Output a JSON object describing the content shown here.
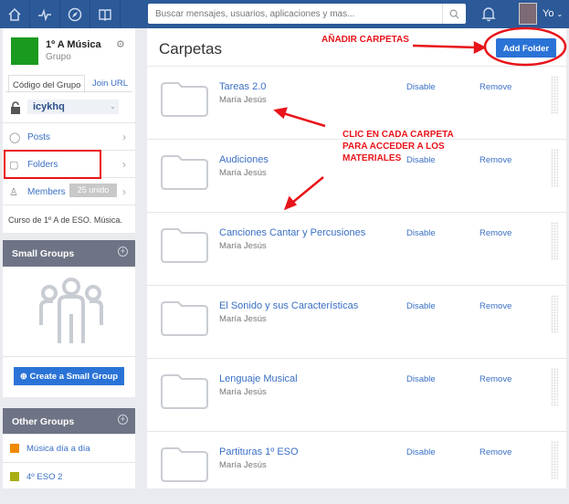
{
  "topbar": {
    "search_placeholder": "Buscar mensajes, usuarios, aplicaciones y mas...",
    "user": "Yo"
  },
  "group": {
    "name": "1º A Música",
    "type": "Grupo",
    "tab_code": "Código del Grupo",
    "tab_join": "Join URL",
    "code": "icykhq",
    "menu": [
      {
        "label": "Posts"
      },
      {
        "label": "Folders"
      },
      {
        "label": "Members",
        "badge": "25 unido"
      }
    ],
    "description": "Curso de 1º A de ESO. Música."
  },
  "small_groups": {
    "title": "Small Groups",
    "create": "Create a Small Group"
  },
  "other_groups": {
    "title": "Other Groups",
    "items": [
      {
        "label": "Música día a día",
        "color": "#f08a00"
      },
      {
        "label": "4º ESO 2",
        "color": "#a8ad16"
      }
    ]
  },
  "main": {
    "title": "Carpetas",
    "add_folder": "Add Folder",
    "disable": "Disable",
    "remove": "Remove",
    "folders": [
      {
        "name": "Tareas 2.0",
        "owner": "María Jesús"
      },
      {
        "name": "Audiciones",
        "owner": "María Jesús"
      },
      {
        "name": "Canciones Cantar y Percusiones",
        "owner": "María Jesús"
      },
      {
        "name": "El Sonido y sus Características",
        "owner": "María Jesús"
      },
      {
        "name": "Lenguaje Musical",
        "owner": "María Jesús"
      },
      {
        "name": "Partituras 1º ESO",
        "owner": "María Jesús"
      }
    ]
  },
  "annotations": {
    "add": "AÑADIR CARPETAS",
    "click": "CLIC EN CADA CARPETA PARA ACCEDER A LOS MATERIALES"
  }
}
